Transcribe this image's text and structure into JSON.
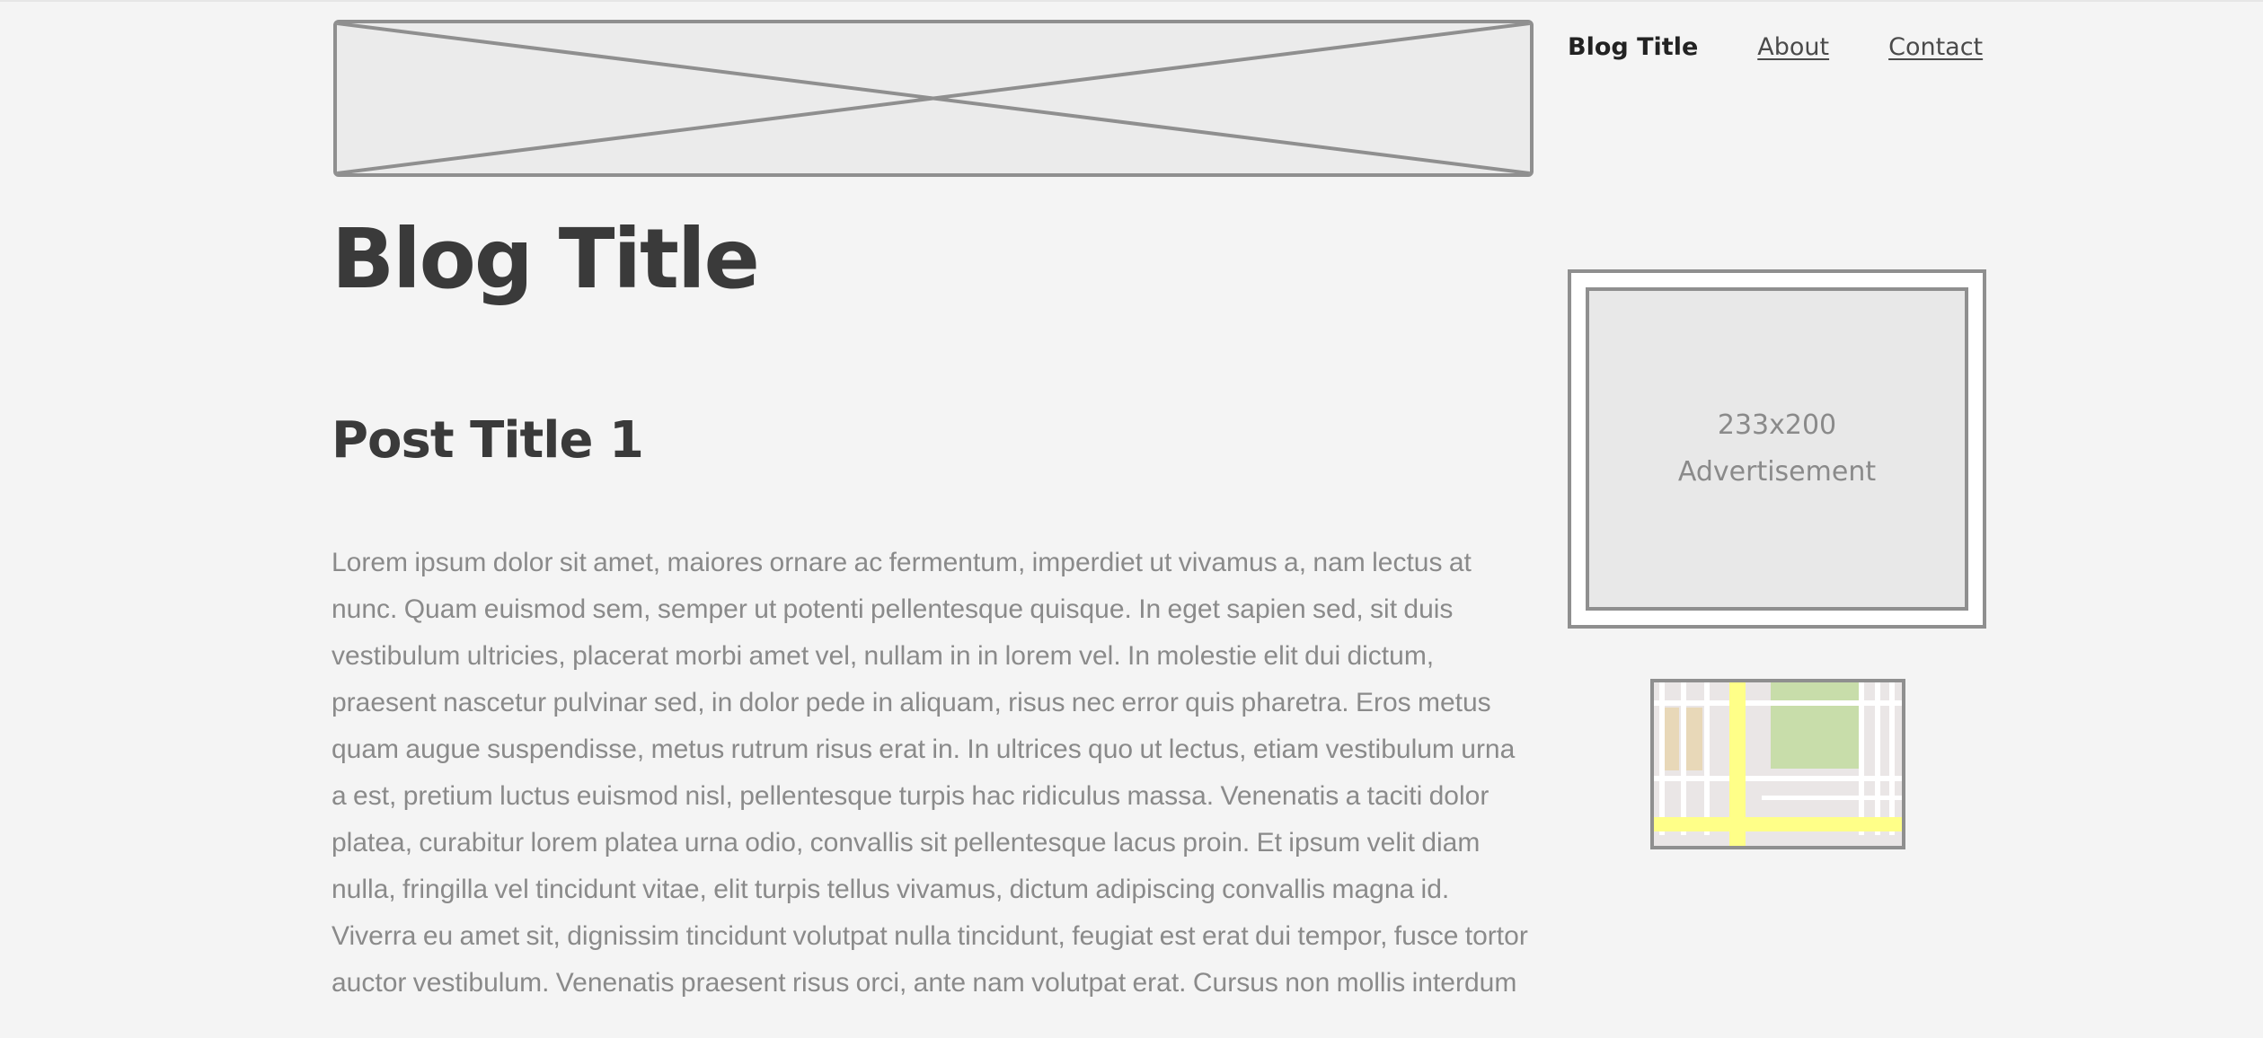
{
  "header": {
    "banner_icon": "image-placeholder-icon",
    "nav": {
      "brand": "Blog Title",
      "links": [
        "About",
        "Contact"
      ]
    }
  },
  "main": {
    "blog_title": "Blog Title",
    "post": {
      "title": "Post Title 1",
      "body": "Lorem ipsum dolor sit amet, maiores ornare ac fermentum, imperdiet ut vivamus a, nam lectus at nunc. Quam euismod sem, semper ut potenti pellentesque quisque. In eget sapien sed, sit duis vestibulum ultricies, placerat morbi amet vel, nullam in in lorem vel. In molestie elit dui dictum, praesent nascetur pulvinar sed, in dolor pede in aliquam, risus nec error quis pharetra. Eros metus quam augue suspendisse, metus rutrum risus erat in.  In ultrices quo ut lectus, etiam vestibulum urna a est, pretium luctus euismod nisl, pellentesque turpis hac ridiculus massa. Venenatis a taciti dolor platea, curabitur lorem platea urna odio, convallis sit pellentesque lacus proin. Et ipsum velit diam nulla, fringilla vel tincidunt vitae, elit turpis tellus vivamus, dictum adipiscing convallis magna id. Viverra eu amet sit, dignissim tincidunt volutpat nulla tincidunt, feugiat est erat dui tempor, fusce tortor auctor vestibulum. Venenatis praesent risus orci, ante nam volutpat erat. Cursus non mollis interdum"
    }
  },
  "sidebar": {
    "ad": {
      "size": "233x200",
      "label": "Advertisement"
    },
    "map_icon": "map-icon"
  },
  "colors": {
    "background": "#f4f4f4",
    "wireframe_border": "#8f8f8f",
    "heading": "#3a3a3a",
    "body_text": "#8a8a8a",
    "map_road_major": "#ffff88",
    "map_park": "#c8ddaa",
    "map_building": "#e8d8b8"
  }
}
